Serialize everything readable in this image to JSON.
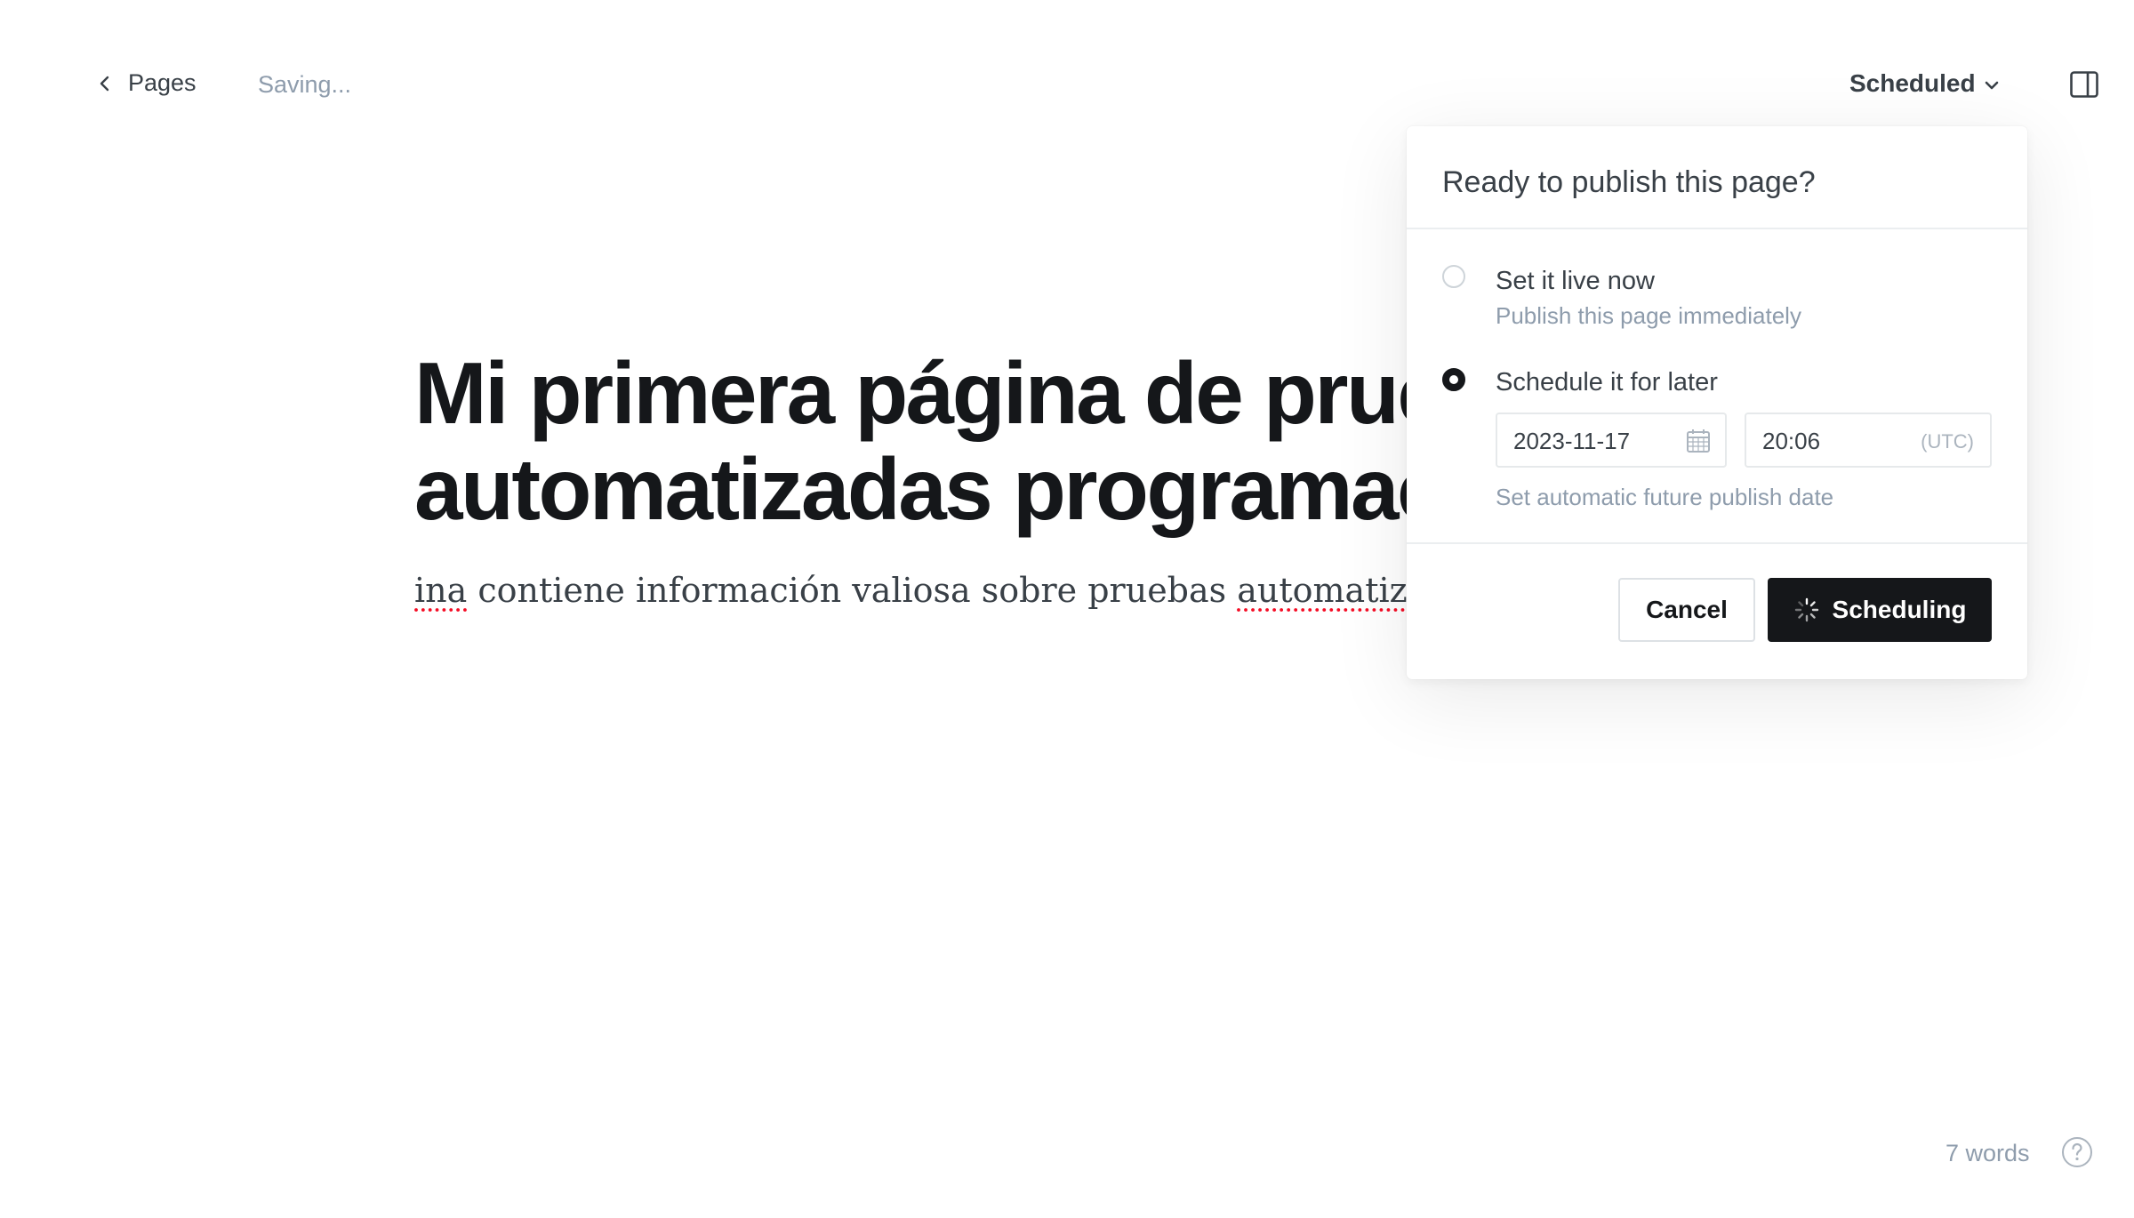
{
  "header": {
    "back_label": "Pages",
    "save_status": "Saving...",
    "post_status": "Scheduled",
    "icons": {
      "back": "chevron-left-icon",
      "status": "chevron-down-icon",
      "sidebar": "sidebar-toggle-icon"
    }
  },
  "editor": {
    "title": "Mi primera página de prue\nautomatizadas programac",
    "body_misspelled_1": "ina",
    "body_middle": " contiene información valiosa sobre pruebas ",
    "body_misspelled_2": "automatizada"
  },
  "publish_popover": {
    "title": "Ready to publish this page?",
    "options": [
      {
        "label": "Set it live now",
        "hint": "Publish this page immediately",
        "selected": false
      },
      {
        "label": "Schedule it for later",
        "hint": "Set automatic future publish date",
        "selected": true
      }
    ],
    "date_value": "2023-11-17",
    "time_value": "20:06",
    "timezone": "(UTC)",
    "cancel_label": "Cancel",
    "schedule_label": "Scheduling"
  },
  "footer": {
    "word_count": "7 words"
  },
  "colors": {
    "text_dark": "#15171a",
    "text_muted": "#8e9cac",
    "button_primary_bg": "#15171a",
    "spellcheck_underline": "#f50b23"
  }
}
